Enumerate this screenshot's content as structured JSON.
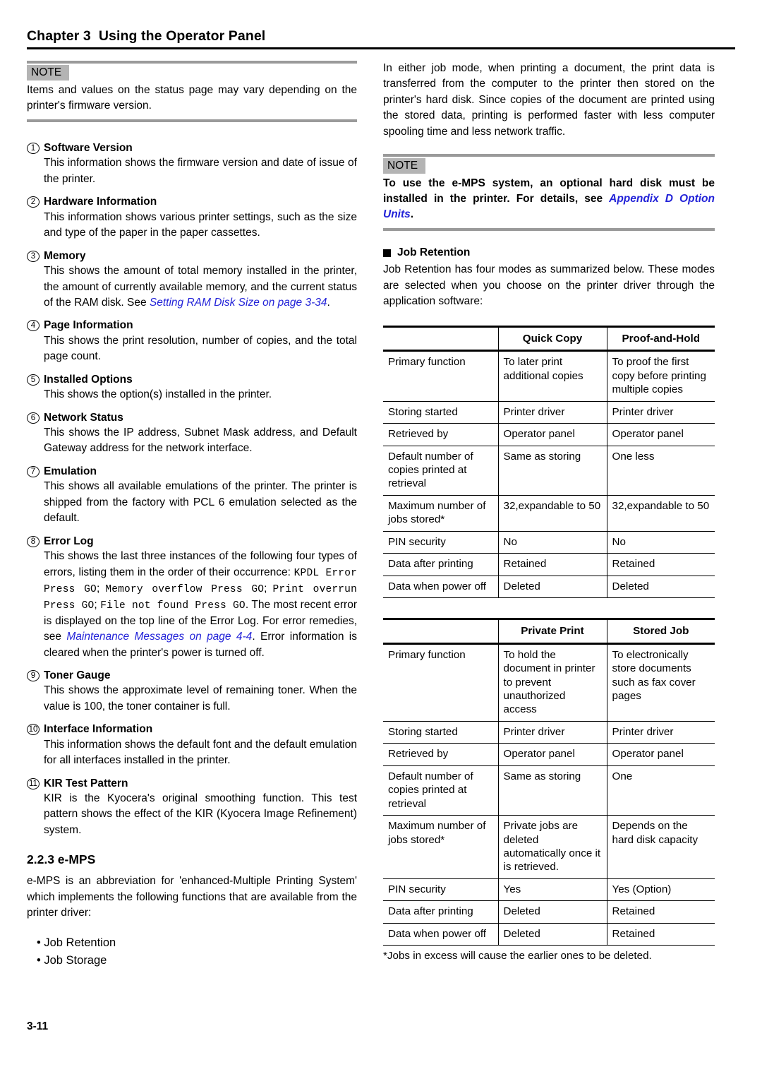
{
  "header": {
    "title": "Chapter 3  Using the Operator Panel"
  },
  "left_column": {
    "note": {
      "label": "NOTE",
      "body": "Items and values on the status page may vary depending on the printer's firmware version."
    },
    "items": [
      {
        "num": "1",
        "title": "Software Version",
        "body": "This information shows the firmware version and date of issue of the printer."
      },
      {
        "num": "2",
        "title": "Hardware Information",
        "body": "This information shows various printer settings, such as the size and type of the paper in the paper cassettes."
      },
      {
        "num": "3",
        "title": "Memory",
        "body_pre": "This shows the amount of total memory installed in the printer, the amount of currently available memory, and the current status of the RAM disk. See ",
        "body_link": "Setting RAM Disk Size on page 3-34",
        "body_post": "."
      },
      {
        "num": "4",
        "title": "Page Information",
        "body": "This shows the print resolution, number of copies, and the total page count."
      },
      {
        "num": "5",
        "title": "Installed Options",
        "body": "This shows the option(s) installed in the printer."
      },
      {
        "num": "6",
        "title": "Network Status",
        "body": "This shows the IP address, Subnet Mask address, and Default Gateway address for the network interface."
      },
      {
        "num": "7",
        "title": "Emulation",
        "body": "This shows all available emulations of the printer. The printer is shipped from the factory with PCL 6 emulation selected as the default."
      },
      {
        "num": "8",
        "title": "Error Log",
        "body_pre": "This shows the last three instances of the following four types of errors, listing them in the order of their occurrence: ",
        "mono1": "KPDL Error Press GO",
        "sep1": "; ",
        "mono2": "Memory overflow Press GO",
        "sep2": "; ",
        "mono3": "Print overrun Press GO",
        "sep3": "; ",
        "mono4": "File not found Press GO",
        "body_mid": ". The most recent error is displayed on the top line of the Error Log. For error remedies, see ",
        "body_link": "Maintenance Messages on page 4-4",
        "body_post": ". Error information is cleared when the printer's power is turned off."
      },
      {
        "num": "9",
        "title": "Toner Gauge",
        "body": "This shows the approximate level of remaining toner. When the value is 100, the toner container is full."
      },
      {
        "num": "10",
        "title": "Interface Information",
        "body": "This information shows the default font and the default emulation for all interfaces installed in the printer."
      },
      {
        "num": "11",
        "title": "KIR Test Pattern",
        "body": "KIR is the Kyocera's original smoothing function. This test pattern shows the effect of the KIR (Kyocera Image Refinement) system."
      }
    ],
    "section": {
      "heading": "2.2.3 e-MPS",
      "paragraph": "e-MPS is an abbreviation for 'enhanced-Multiple Printing System' which implements the following functions that are available from the printer driver:",
      "bullets": [
        "• Job Retention",
        "• Job Storage"
      ]
    }
  },
  "right_column": {
    "intro_paragraph": "In either job mode, when printing a document, the print data is transferred from the computer to the printer then stored on the printer's hard disk. Since copies of the document are printed using the stored data, printing is performed faster with less computer spooling time and less network traffic.",
    "note": {
      "label": "NOTE",
      "body_pre": "To use the e-MPS system, an optional hard disk must be installed in the printer. For details, see ",
      "body_link": "Appendix D Option Units",
      "body_post": "."
    },
    "subsection": {
      "heading": "Job Retention",
      "paragraph": "Job Retention has four modes as summarized below. These modes are selected when you choose on the printer driver through the application software:"
    },
    "table1": {
      "headers": [
        "",
        "Quick Copy",
        "Proof-and-Hold"
      ],
      "rows": [
        [
          "Primary function",
          "To later print additional copies",
          "To proof the first copy before printing multiple copies"
        ],
        [
          "Storing started",
          "Printer driver",
          "Printer driver"
        ],
        [
          "Retrieved by",
          "Operator panel",
          "Operator panel"
        ],
        [
          "Default number of copies printed at retrieval",
          "Same as storing",
          "One less"
        ],
        [
          "Maximum number of jobs stored*",
          "32,expandable to 50",
          "32,expandable to 50"
        ],
        [
          "PIN security",
          "No",
          "No"
        ],
        [
          "Data after printing",
          "Retained",
          "Retained"
        ],
        [
          "Data when power off",
          "Deleted",
          "Deleted"
        ]
      ]
    },
    "table2": {
      "headers": [
        "",
        "Private Print",
        "Stored Job"
      ],
      "rows": [
        [
          "Primary function",
          "To hold the document in printer to prevent unauthorized access",
          "To electronically store documents such as fax cover pages"
        ],
        [
          "Storing started",
          "Printer driver",
          "Printer driver"
        ],
        [
          "Retrieved by",
          "Operator panel",
          "Operator panel"
        ],
        [
          "Default number of copies printed at retrieval",
          "Same as storing",
          "One"
        ],
        [
          "Maximum number of jobs stored*",
          "Private jobs are deleted automatically once it is retrieved.",
          "Depends on the hard disk capacity"
        ],
        [
          "PIN security",
          "Yes",
          "Yes (Option)"
        ],
        [
          "Data after printing",
          "Deleted",
          "Retained"
        ],
        [
          "Data when power off",
          "Deleted",
          "Retained"
        ]
      ]
    },
    "table_footnote": "*Jobs in excess will cause the earlier ones to be deleted."
  },
  "footer": {
    "page_number": "3-11"
  },
  "colors": {
    "link": "#2222d8",
    "note_rule": "#9a9a9a",
    "note_label_bg": "#b4b4b4"
  }
}
